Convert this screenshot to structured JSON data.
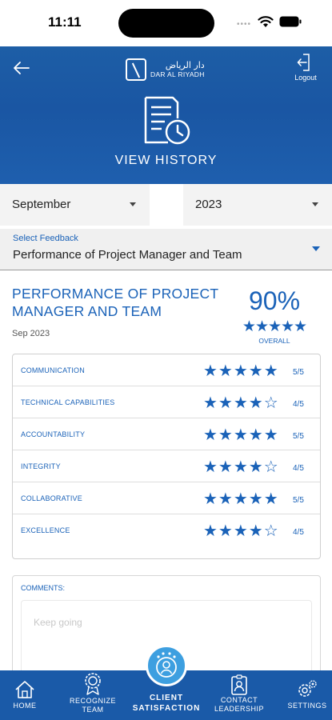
{
  "status_bar": {
    "time": "11:11",
    "signal_dots": "••••"
  },
  "header": {
    "logo_arabic": "دار الرياض",
    "logo_english": "DAR AL RIYADH",
    "logout_label": "Logout",
    "title": "VIEW HISTORY",
    "background_color": "#1a56a3"
  },
  "filters": {
    "month": "September",
    "year": "2023"
  },
  "feedback": {
    "label": "Select Feedback",
    "value": "Performance of Project Manager and Team"
  },
  "performance": {
    "title": "PERFORMANCE OF PROJECT MANAGER AND TEAM",
    "date": "Sep 2023",
    "overall_percent": "90%",
    "overall_stars": "★★★★★",
    "overall_label": "OVERALL",
    "ratings": [
      {
        "label": "COMMUNICATION",
        "stars": "★★★★★",
        "score": "5/5"
      },
      {
        "label": "TECHNICAL CAPABILITIES",
        "stars": "★★★★☆",
        "score": "4/5"
      },
      {
        "label": "ACCOUNTABILITY",
        "stars": "★★★★★",
        "score": "5/5"
      },
      {
        "label": "INTEGRITY",
        "stars": "★★★★☆",
        "score": "4/5"
      },
      {
        "label": "COLLABORATIVE",
        "stars": "★★★★★",
        "score": "5/5"
      },
      {
        "label": "EXCELLENCE",
        "stars": "★★★★☆",
        "score": "4/5"
      }
    ]
  },
  "comments": {
    "label": "COMMENTS:",
    "text": "Keep going"
  },
  "bottom_nav": {
    "home": "HOME",
    "recognize_line1": "RECOGNIZE",
    "recognize_line2": "TEAM",
    "client_line1": "CLIENT",
    "client_line2": "SATISFACTION",
    "contact_line1": "CONTACT",
    "contact_line2": "LEADERSHIP",
    "settings": "SETTINGS"
  },
  "colors": {
    "accent": "#1a62b8",
    "nav_bg": "#1a5aa8",
    "center_button": "#3d9fe0"
  }
}
